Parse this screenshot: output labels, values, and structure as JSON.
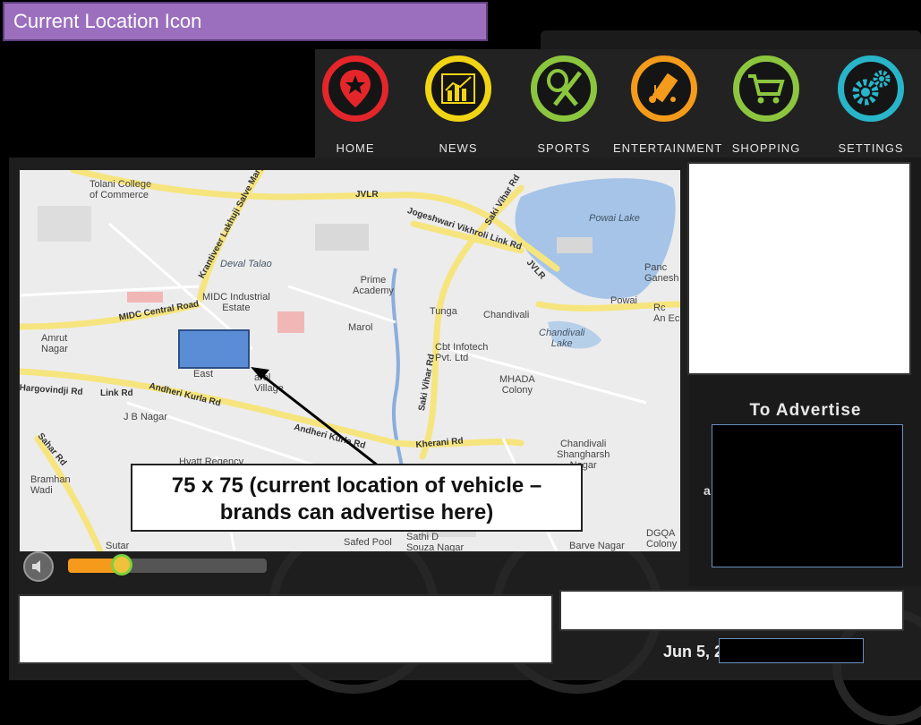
{
  "banner": {
    "title": "Current Location Icon"
  },
  "nav": {
    "items": [
      {
        "label": "HOME",
        "color": "#e4262b",
        "icon": "map-pin-star-icon"
      },
      {
        "label": "NEWS",
        "color": "#f1d414",
        "icon": "bar-chart-icon"
      },
      {
        "label": "SPORTS",
        "color": "#8cc63f",
        "icon": "racket-bat-icon"
      },
      {
        "label": "ENTERTAINMENT",
        "color": "#f49b1c",
        "icon": "film-music-icon"
      },
      {
        "label": "SHOPPING",
        "color": "#8cc63f",
        "icon": "shopping-cart-icon"
      },
      {
        "label": "SETTINGS",
        "color": "#29b5c9",
        "icon": "gears-icon"
      }
    ]
  },
  "map": {
    "labels": {
      "tolani": "Tolani College\nof Commerce",
      "jvlr_top": "JVLR",
      "jogeshwari": "Jogeshwari Vikhroli Link Rd",
      "saki_vihar_top": "Saki Vihar Rd",
      "powai_lake": "Powai Lake",
      "panch": "Panc\nGanesh",
      "krantiveer": "Krantiveer Lakhuji Salve Marg",
      "deval_talao": "Deval Talao",
      "prime": "Prime\nAcademy",
      "jvlr_right": "JVLR",
      "powai": "Powai",
      "midc_ind": "MIDC Industrial\nEstate",
      "midc_central": "MIDC Central Road",
      "tunga": "Tunga",
      "chandivali": "Chandivali",
      "rc_an": "Rc\nAn Ec",
      "amrut": "Amrut\nNagar",
      "marol": "Marol",
      "chandivali_lake": "Chandivali\nLake",
      "cbt": "Cbt Infotech\nPvt. Ltd",
      "east": "East",
      "marol_village": "arol\nVillage",
      "hargovindji": "Hargovindji Rd",
      "link_rd": "Link Rd",
      "andheri_kurla": "Andheri Kurla Rd",
      "saki_vihar_mid": "Saki Vihar Rd",
      "mhada": "MHADA\nColony",
      "jb_nagar": "J B Nagar",
      "andheri_kurla_2": "Andheri Kurla Rd",
      "kherani": "Kherani Rd",
      "hyatt": "Hyatt Regency",
      "chandivali_shang": "Chandivali\nShangharsh\nNagar",
      "sahar": "Sahar Rd",
      "bramhan": "Bramhan\nWadi",
      "sutar": "Sutar",
      "safed_pool": "Safed Pool",
      "sathi": "Sathi D\nSouza Nagar",
      "barve": "Barve Nagar",
      "dgqa": "DGQA\nColony"
    }
  },
  "callout": {
    "line1": "75 x 75 (current location of vehicle –",
    "line2": "brands can advertise here)"
  },
  "audio": {
    "progress": 0.27
  },
  "sidebar": {
    "advertise_label": "To Advertise",
    "peek_text": "a"
  },
  "footer": {
    "date": "Jun 5, 2"
  }
}
